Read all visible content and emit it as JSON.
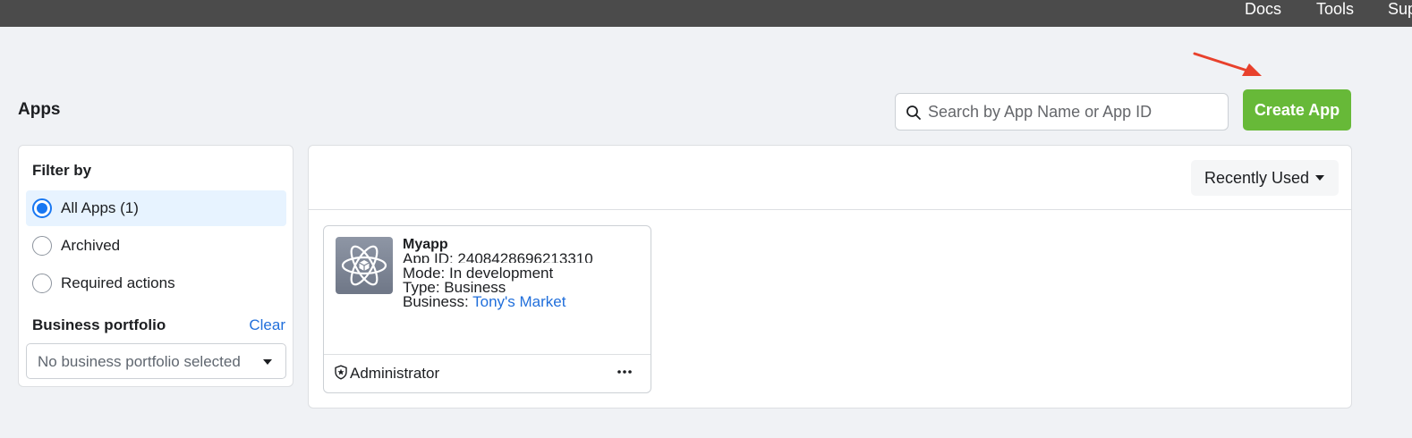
{
  "topbar": {
    "docs": "Docs",
    "tools": "Tools",
    "support": "Support"
  },
  "page": {
    "title": "Apps"
  },
  "search": {
    "placeholder": "Search by App Name or App ID",
    "value": ""
  },
  "create_button": {
    "label": "Create App"
  },
  "filter": {
    "title": "Filter by",
    "options": [
      {
        "label": "All Apps (1)",
        "selected": true
      },
      {
        "label": "Archived",
        "selected": false
      },
      {
        "label": "Required actions",
        "selected": false
      }
    ],
    "business_portfolio": {
      "title": "Business portfolio",
      "clear_label": "Clear",
      "selected": "No business portfolio selected"
    }
  },
  "sort": {
    "label": "Recently Used"
  },
  "apps": [
    {
      "name": "Myapp",
      "app_id": "App ID: 2408428696213310",
      "mode": "Mode: In development",
      "type": "Type: Business",
      "business_label": "Business: ",
      "business_name": "Tony's Market",
      "role": "Administrator"
    }
  ],
  "colors": {
    "topbar": "#4b4b4b",
    "background": "#f0f2f5",
    "create_button": "#67b938",
    "link": "#216fdb",
    "selected_row": "#e7f3ff",
    "radio_selected": "#1877f2",
    "annotation_arrow": "#e8412c"
  },
  "icons": {
    "search": "search-icon",
    "app": "atom-icon",
    "role": "shield-star-icon",
    "more": "more-horizontal-icon",
    "caret": "caret-down-icon"
  }
}
